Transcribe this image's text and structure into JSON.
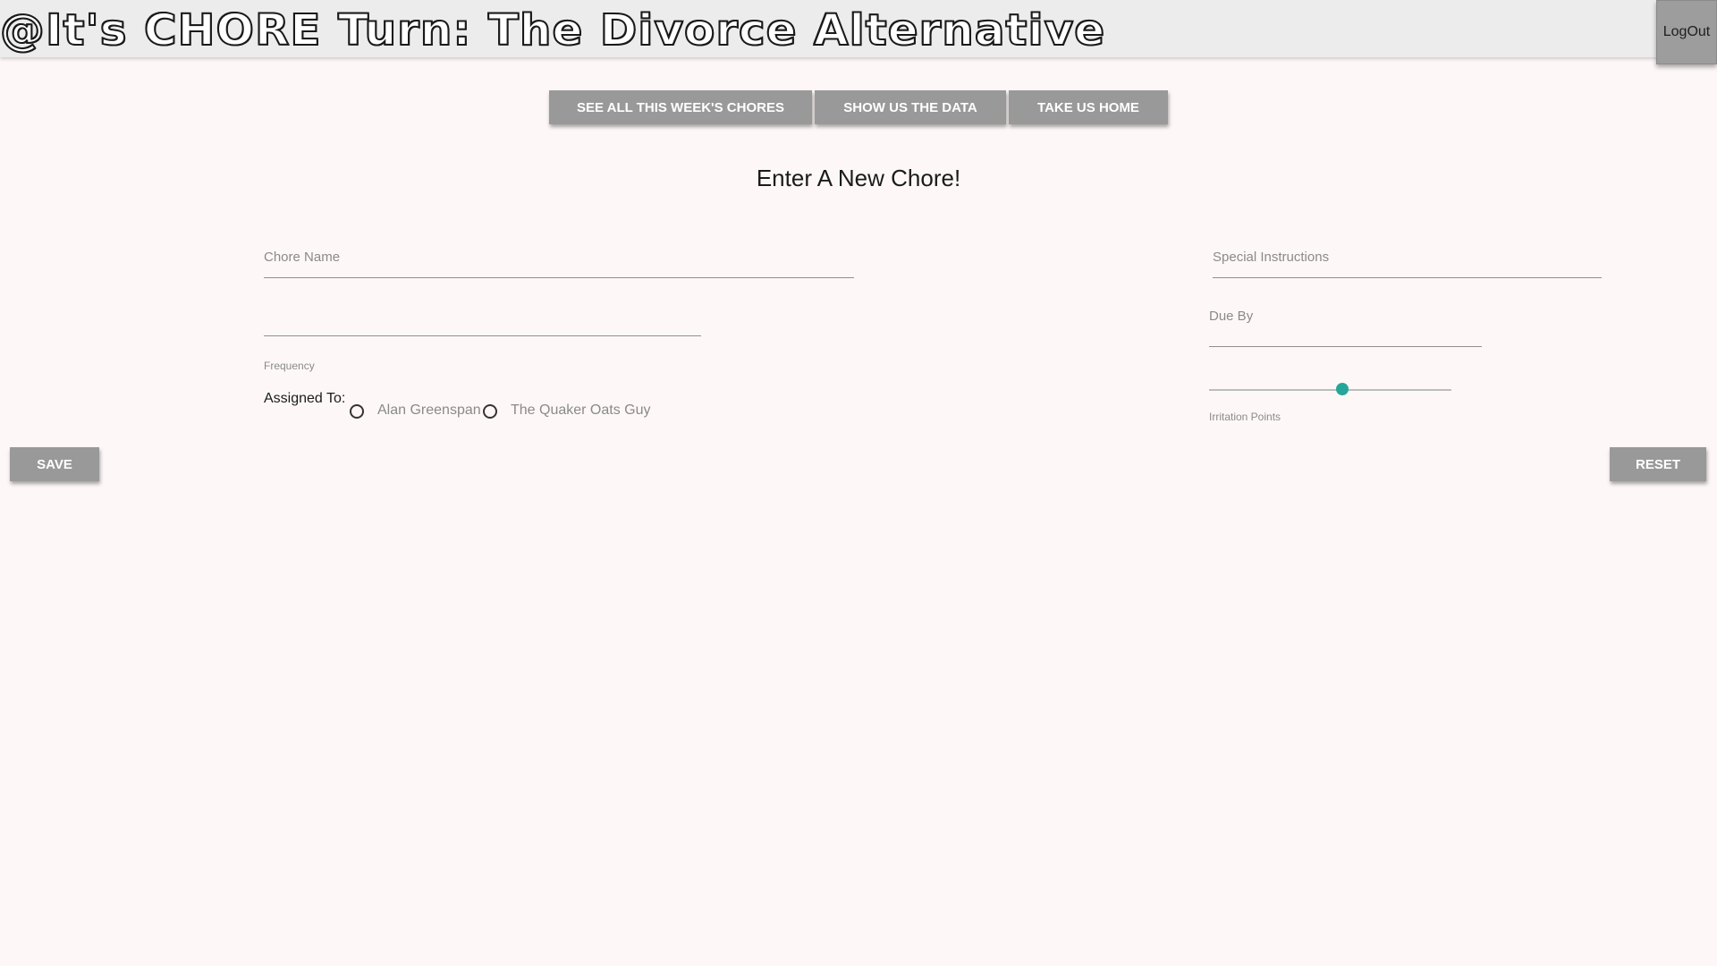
{
  "header": {
    "title": "@It's CHORE Turn: The Divorce Alternative",
    "logout_label": "LogOut"
  },
  "nav": {
    "items": [
      {
        "label": "SEE ALL THIS WEEK'S CHORES"
      },
      {
        "label": "SHOW US THE DATA"
      },
      {
        "label": "TAKE US HOME"
      }
    ]
  },
  "form": {
    "title": "Enter A New Chore!",
    "chore_name_label": "Chore Name",
    "chore_name_value": "",
    "special_instructions_label": "Special Instructions",
    "special_instructions_value": "",
    "due_by_label": "Due By",
    "due_by_value": "",
    "frequency_label": "Frequency",
    "frequency_value": "",
    "assigned_to_label": "Assigned To:",
    "assignees": [
      {
        "label": "Alan Greenspan",
        "selected": false
      },
      {
        "label": "The Quaker Oats Guy",
        "selected": false
      }
    ],
    "irritation_label": "Irritation Points",
    "irritation_value_fraction": 0.55,
    "accent_color": "#26a69a"
  },
  "actions": {
    "save_label": "SAVE",
    "reset_label": "RESET"
  }
}
